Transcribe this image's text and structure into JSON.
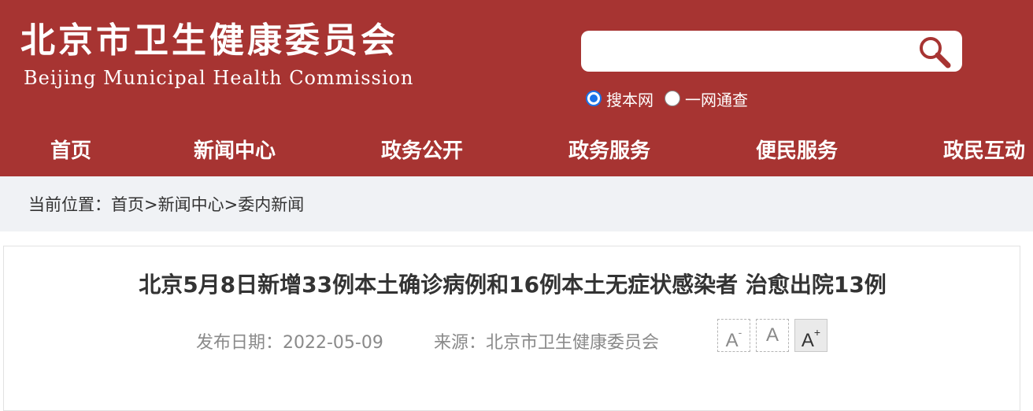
{
  "header": {
    "logo_cn": "北京市卫生健康委员会",
    "logo_en": "Beijing Municipal Health Commission"
  },
  "search": {
    "value": "",
    "placeholder": "",
    "icon": "search-icon",
    "scope_options": [
      {
        "label": "搜本网",
        "selected": true
      },
      {
        "label": "一网通查",
        "selected": false
      }
    ]
  },
  "nav": {
    "items": [
      "首页",
      "新闻中心",
      "政务公开",
      "政务服务",
      "便民服务",
      "政民互动"
    ]
  },
  "breadcrumb": {
    "prefix": "当前位置：",
    "items": [
      "首页",
      "新闻中心",
      "委内新闻"
    ],
    "separator": ">"
  },
  "article": {
    "title": "北京5月8日新增33例本土确诊病例和16例本土无症状感染者 治愈出院13例",
    "publish_date_label": "发布日期：2022-05-09",
    "source_label": "来源：北京市卫生健康委员会"
  },
  "font_size_controls": [
    {
      "label": "A",
      "suffix": "-",
      "active": false
    },
    {
      "label": "A",
      "suffix": "",
      "active": false
    },
    {
      "label": "A",
      "suffix": "+",
      "active": true
    }
  ],
  "colors": {
    "header_bg": "#a73432",
    "breadcrumb_bg": "#f0f2f5",
    "radio_accent": "#1a73e8"
  }
}
